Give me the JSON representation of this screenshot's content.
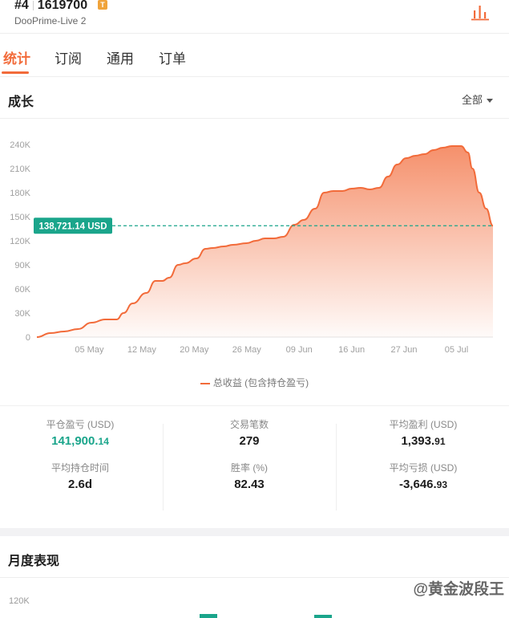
{
  "header": {
    "rank": "#4",
    "account_id": "1619700",
    "badge": "T",
    "server": "DooPrime-Live 2",
    "icon": "bar-chart-icon"
  },
  "tabs": [
    {
      "label": "统计",
      "active": true
    },
    {
      "label": "订阅",
      "active": false
    },
    {
      "label": "通用",
      "active": false
    },
    {
      "label": "订单",
      "active": false
    }
  ],
  "growth": {
    "title": "成长",
    "filter": "全部"
  },
  "chart_data": {
    "type": "area",
    "title": "成长",
    "xlabel": "",
    "ylabel": "",
    "ylim": [
      0,
      250000
    ],
    "yticks": [
      0,
      30000,
      60000,
      90000,
      120000,
      150000,
      180000,
      210000,
      240000
    ],
    "ytick_labels": [
      "0",
      "30K",
      "60K",
      "90K",
      "120K",
      "150K",
      "180K",
      "210K",
      "240K"
    ],
    "xticks": [
      "05 May",
      "12 May",
      "20 May",
      "26 May",
      "09 Jun",
      "16 Jun",
      "27 Jun",
      "05 Jul"
    ],
    "x_range": [
      0,
      100
    ],
    "xtick_positions": [
      11.5,
      23,
      34.5,
      46,
      57.5,
      69,
      80.5,
      92
    ],
    "grid": false,
    "legend_position": "bottom",
    "current_value": 138721.14,
    "current_label": "138,721.14 USD",
    "series": [
      {
        "name": "总收益 (包含持仓盈亏)",
        "color": "#f26b3a",
        "x": [
          0,
          3,
          6,
          9,
          12,
          15,
          17.5,
          19,
          21,
          24,
          26,
          27.5,
          29,
          31,
          32.5,
          35,
          37,
          38.5,
          41,
          43,
          46,
          48,
          50,
          52,
          54,
          56.5,
          58.5,
          61,
          63,
          65,
          67,
          69,
          71,
          73,
          75,
          77,
          79,
          81,
          83,
          85,
          87,
          89,
          91,
          93,
          94.5,
          95.5,
          97,
          98.5,
          100
        ],
        "y": [
          0,
          5000,
          7000,
          10000,
          18000,
          22000,
          22000,
          30000,
          42000,
          55000,
          70000,
          70000,
          74000,
          90000,
          92000,
          98000,
          110000,
          111000,
          113000,
          115000,
          117000,
          120000,
          123000,
          123000,
          125000,
          140000,
          146000,
          160000,
          180000,
          182000,
          182000,
          185000,
          186000,
          184000,
          186000,
          200000,
          215000,
          223000,
          226000,
          228000,
          233000,
          236000,
          238000,
          238000,
          230000,
          210000,
          180000,
          160000,
          138721
        ]
      }
    ]
  },
  "stats": [
    {
      "label": "平仓盈亏 (USD)",
      "int": "141,900.",
      "dec": "14",
      "green": true
    },
    {
      "label": "平均持仓时间",
      "int": "2.6d",
      "dec": "",
      "green": false
    },
    {
      "label": "交易笔数",
      "int": "279",
      "dec": "",
      "green": false
    },
    {
      "label": "胜率 (%)",
      "int": "82.43",
      "dec": "",
      "green": false
    },
    {
      "label": "平均盈利 (USD)",
      "int": "1,393.",
      "dec": "91",
      "green": false
    },
    {
      "label": "平均亏损 (USD)",
      "int": "-3,646.",
      "dec": "93",
      "green": false
    }
  ],
  "monthly": {
    "title": "月度表现",
    "tick": "120K"
  },
  "watermark": "@黄金波段王"
}
